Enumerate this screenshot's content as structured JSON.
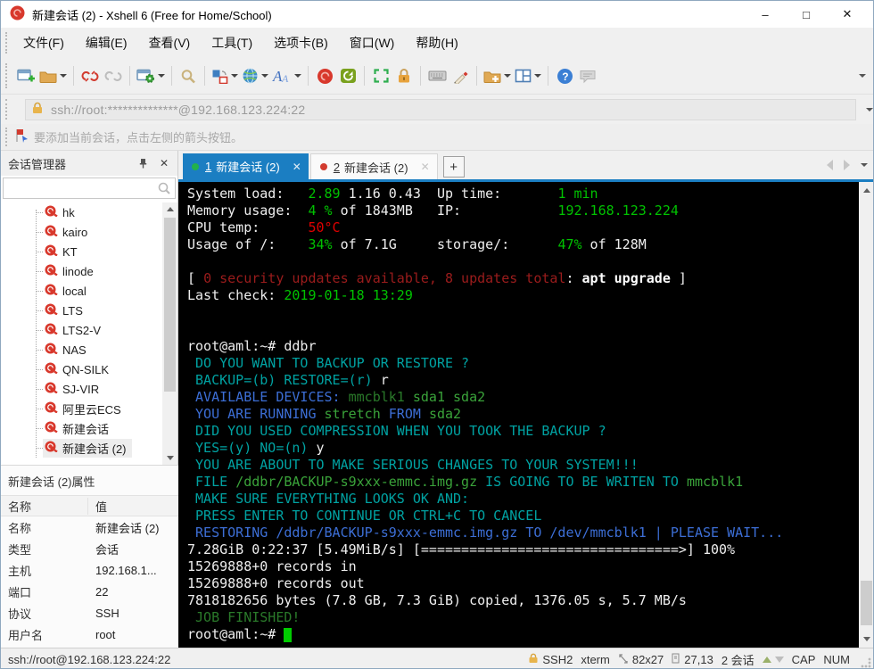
{
  "window": {
    "title": "新建会话 (2) - Xshell 6 (Free for Home/School)",
    "minimize": "–",
    "maximize": "□",
    "close": "✕"
  },
  "menu": {
    "items": [
      "文件(F)",
      "编辑(E)",
      "查看(V)",
      "工具(T)",
      "选项卡(B)",
      "窗口(W)",
      "帮助(H)"
    ]
  },
  "toolbar": {
    "items": [
      {
        "name": "new-session"
      },
      {
        "name": "open-folder",
        "dropdown": true
      },
      {
        "sep": true
      },
      {
        "name": "disconnect"
      },
      {
        "name": "reconnect"
      },
      {
        "sep": true
      },
      {
        "name": "session-properties",
        "dropdown": true
      },
      {
        "sep": true
      },
      {
        "name": "find"
      },
      {
        "sep": true
      },
      {
        "name": "arrange",
        " ": "",
        "dropdown": true
      },
      {
        "name": "encoding-globe",
        "dropdown": true
      },
      {
        "name": "font",
        "dropdown": true
      },
      {
        "sep": true
      },
      {
        "name": "xshell-logo"
      },
      {
        "name": "xftp"
      },
      {
        "sep": true
      },
      {
        "name": "fullscreen"
      },
      {
        "name": "lock"
      },
      {
        "sep": true
      },
      {
        "name": "keyboard"
      },
      {
        "name": "highlight-pen"
      },
      {
        "sep": true
      },
      {
        "name": "new-folder",
        "dropdown": true
      },
      {
        "name": "layout",
        "dropdown": true
      },
      {
        "sep": true
      },
      {
        "name": "help"
      },
      {
        "name": "message"
      }
    ]
  },
  "address_bar": {
    "url": "ssh://root:**************@192.168.123.224:22"
  },
  "info_bar": {
    "text": "要添加当前会话，点击左侧的箭头按钮。"
  },
  "session_manager": {
    "title": "会话管理器",
    "search_value": "",
    "sessions": [
      {
        "label": "hk"
      },
      {
        "label": "kairo"
      },
      {
        "label": "KT"
      },
      {
        "label": "linode"
      },
      {
        "label": "local"
      },
      {
        "label": "LTS"
      },
      {
        "label": "LTS2-V"
      },
      {
        "label": "NAS"
      },
      {
        "label": "QN-SILK"
      },
      {
        "label": "SJ-VIR"
      },
      {
        "label": "阿里云ECS"
      },
      {
        "label": "新建会话"
      },
      {
        "label": "新建会话 (2)",
        "selected": true
      }
    ]
  },
  "properties": {
    "title": "新建会话 (2)属性",
    "columns": [
      "名称",
      "值"
    ],
    "rows": [
      [
        "名称",
        "新建会话 (2)"
      ],
      [
        "类型",
        "会话"
      ],
      [
        "主机",
        "192.168.1..."
      ],
      [
        "端口",
        "22"
      ],
      [
        "协议",
        "SSH"
      ],
      [
        "用户名",
        "root"
      ]
    ]
  },
  "tabs": {
    "items": [
      {
        "number": "1",
        "label": "新建会话 (2)",
        "active": true,
        "dot_color": "#22b14c",
        "close": "✕"
      },
      {
        "number": "2",
        "label": "新建会话 (2)",
        "active": false,
        "dot_color": "#d23b2f",
        "close": "✕"
      }
    ],
    "new_tab_label": "+"
  },
  "terminal": {
    "palette": {
      "w": "#eeeeee",
      "wb": "#ffffff",
      "g": "#00c200",
      "g2": "#3aa33a",
      "g3": "#2a7a2a",
      "r": "#e00000",
      "dr": "#9b1c1c",
      "c": "#00a2a2",
      "b": "#3c6ed5"
    },
    "cursor_color": "#00cc00",
    "lines": [
      [
        {
          "c": "w",
          "t": "System load:   "
        },
        {
          "c": "g",
          "t": "2.89"
        },
        {
          "c": "w",
          "t": " 1.16 0.43  Up time:       "
        },
        {
          "c": "g",
          "t": "1 min"
        }
      ],
      [
        {
          "c": "w",
          "t": "Memory usage:  "
        },
        {
          "c": "g",
          "t": "4 %"
        },
        {
          "c": "w",
          "t": " of 1843MB   IP:            "
        },
        {
          "c": "g",
          "t": "192.168.123.224"
        }
      ],
      [
        {
          "c": "w",
          "t": "CPU temp:      "
        },
        {
          "c": "r",
          "t": "50°C"
        }
      ],
      [
        {
          "c": "w",
          "t": "Usage of /:    "
        },
        {
          "c": "g",
          "t": "34%"
        },
        {
          "c": "w",
          "t": " of 7.1G     storage/:      "
        },
        {
          "c": "g",
          "t": "47%"
        },
        {
          "c": "w",
          "t": " of 128M"
        }
      ],
      [],
      [
        {
          "c": "w",
          "t": "[ "
        },
        {
          "c": "dr",
          "t": "0 security updates available, 8 updates total"
        },
        {
          "c": "w",
          "t": ": "
        },
        {
          "c": "wb",
          "t": "apt upgrade"
        },
        {
          "c": "w",
          "t": " ]"
        }
      ],
      [
        {
          "c": "w",
          "t": "Last check: "
        },
        {
          "c": "g",
          "t": "2019-01-18 13:29"
        }
      ],
      [],
      [],
      [
        {
          "c": "w",
          "t": "root@aml:~# ddbr"
        }
      ],
      [
        {
          "c": "c",
          "t": " DO YOU WANT TO BACKUP OR RESTORE ?"
        }
      ],
      [
        {
          "c": "c",
          "t": " BACKUP=(b) RESTORE=(r) "
        },
        {
          "c": "w",
          "t": "r"
        }
      ],
      [
        {
          "c": "b",
          "t": " AVAILABLE DEVICES: "
        },
        {
          "c": "g3",
          "t": "mmcblk1"
        },
        {
          "c": "w",
          "t": " "
        },
        {
          "c": "g2",
          "t": "sda1 sda2"
        }
      ],
      [
        {
          "c": "b",
          "t": " YOU ARE RUNNING "
        },
        {
          "c": "g2",
          "t": "stretch"
        },
        {
          "c": "b",
          "t": " FROM "
        },
        {
          "c": "g2",
          "t": "sda2"
        }
      ],
      [
        {
          "c": "c",
          "t": " DID YOU USED COMPRESSION WHEN YOU TOOK THE BACKUP ?"
        }
      ],
      [
        {
          "c": "c",
          "t": " YES=(y) NO=(n) "
        },
        {
          "c": "w",
          "t": "y"
        }
      ],
      [
        {
          "c": "c",
          "t": " YOU ARE ABOUT TO MAKE SERIOUS CHANGES TO YOUR SYSTEM!!!"
        }
      ],
      [
        {
          "c": "c",
          "t": " FILE "
        },
        {
          "c": "g2",
          "t": "/ddbr/BACKUP-s9xxx-emmc.img.gz"
        },
        {
          "c": "c",
          "t": " IS GOING TO BE WRITEN TO "
        },
        {
          "c": "g2",
          "t": "mmcblk1"
        }
      ],
      [
        {
          "c": "c",
          "t": " MAKE SURE EVERYTHING LOOKS OK AND:"
        }
      ],
      [
        {
          "c": "c",
          "t": " PRESS ENTER TO CONTINUE OR CTRL+C TO CANCEL"
        }
      ],
      [
        {
          "c": "b",
          "t": " RESTORING /ddbr/BACKUP-s9xxx-emmc.img.gz TO /dev/mmcblk1 | PLEASE WAIT..."
        }
      ],
      [
        {
          "c": "w",
          "t": "7.28GiB 0:22:37 [5.49MiB/s] [================================>] 100%"
        }
      ],
      [
        {
          "c": "w",
          "t": "15269888+0 records in"
        }
      ],
      [
        {
          "c": "w",
          "t": "15269888+0 records out"
        }
      ],
      [
        {
          "c": "w",
          "t": "7818182656 bytes (7.8 GB, 7.3 GiB) copied, 1376.05 s, 5.7 MB/s"
        }
      ],
      [
        {
          "c": "g3",
          "t": " JOB FINISHED!"
        }
      ],
      [
        {
          "c": "w",
          "t": "root@aml:~# ",
          "cursor_after": true
        }
      ]
    ]
  },
  "status_bar": {
    "url": "ssh://root@192.168.123.224:22",
    "protocol": "SSH2",
    "term_type": "xterm",
    "size": "82x27",
    "position": "27,13",
    "sessions": "2 会话",
    "cap": "CAP",
    "num": "NUM"
  },
  "colors": {
    "active_tab": "#1b7ec2",
    "terminal_bg": "#000000",
    "brand_red": "#d8382c",
    "xftp_green": "#7aa11e"
  }
}
